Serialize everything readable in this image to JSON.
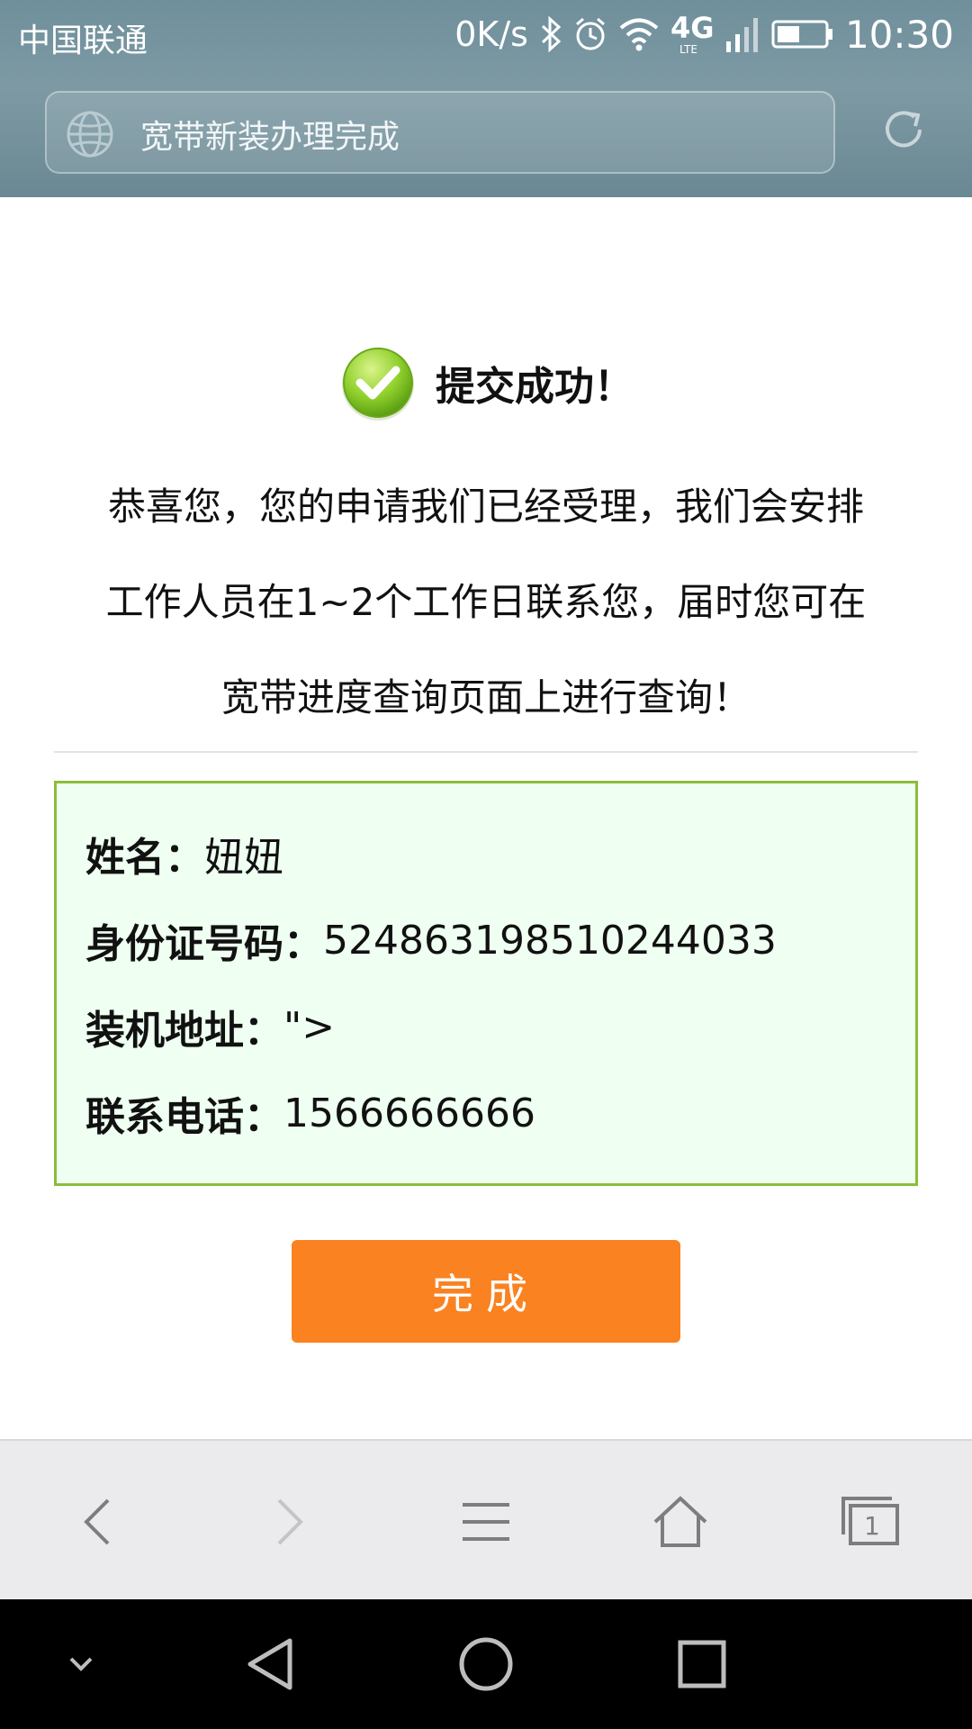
{
  "status_bar": {
    "carrier": "中国联通",
    "net_speed": "0K/s",
    "network": "4G",
    "network_sub": "LTE",
    "time": "10:30"
  },
  "address_bar": {
    "title": "宽带新装办理完成"
  },
  "success": {
    "title": "提交成功！",
    "message_lines": [
      "恭喜您，您的申请我们已经受理，我们会安排",
      "工作人员在1~2个工作日联系您，届时您可在",
      "宽带进度查询页面上进行查询！"
    ]
  },
  "info": {
    "name_label": "姓名：",
    "name_value": "妞妞",
    "id_label": "身份证号码：",
    "id_value": "524863198510244033",
    "address_label": "装机地址：",
    "address_value": "\">",
    "phone_label": "联系电话：",
    "phone_value": "1566666666"
  },
  "done_button": {
    "label": "完成"
  },
  "browser_toolbar": {
    "tab_count": "1"
  },
  "colors": {
    "accent_button": "#fa8220",
    "info_border": "#8cbd3a",
    "info_background": "#effff2",
    "header": "#7490a0"
  }
}
